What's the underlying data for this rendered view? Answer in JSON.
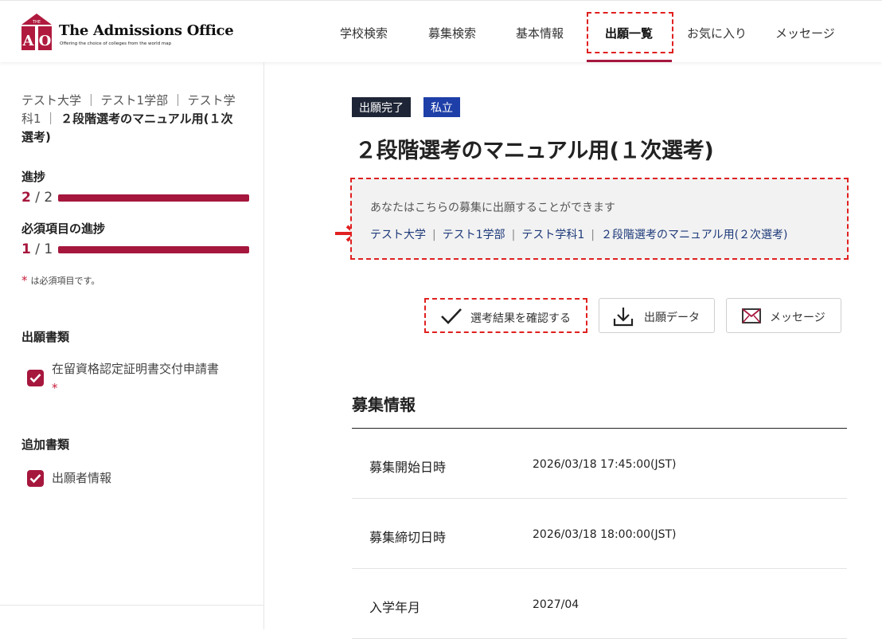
{
  "header": {
    "logo_title": "The Admissions Office",
    "logo_tagline": "Offering the choice of colleges from the world map",
    "logo_mark_text": "AO",
    "logo_mark_small": "THE",
    "nav": [
      "学校検索",
      "募集検索",
      "基本情報",
      "出願一覧",
      "お気に入り",
      "メッセージ"
    ],
    "active_nav": "出願一覧"
  },
  "sidebar": {
    "breadcrumb_line1": "テスト大学 ｜ テスト1学部 ｜ テスト学",
    "breadcrumb_line2": "科1 ｜",
    "breadcrumb_bold": "２段階選考のマニュアル用(１次選考)",
    "progress_label": "進捗",
    "progress_current": "2",
    "progress_total": "/ 2",
    "progress_fraction": 1.0,
    "required_label": "必須項目の進捗",
    "required_current": "1",
    "required_total": "/ 1",
    "required_fraction": 1.0,
    "required_star": "*",
    "required_note": "は必須項目です。",
    "documents_label": "出願書類",
    "documents": [
      {
        "label": "在留資格認定証明書交付申請書",
        "required": true,
        "checked": true
      }
    ],
    "additional_label": "追加書類",
    "additional": [
      {
        "label": "出願者情報",
        "checked": true
      }
    ]
  },
  "main": {
    "tags": [
      "出願完了",
      "私立"
    ],
    "title": "２段階選考のマニュアル用(１次選考)",
    "info_text": "あなたはこちらの募集に出願することができます",
    "info_link_parts": [
      "テスト大学",
      "テスト1学部",
      "テスト学科1",
      "２段階選考のマニュアル用(２次選考)"
    ],
    "buttons": {
      "check_results": "選考結果を確認する",
      "download": "出願データ",
      "message": "メッセージ"
    },
    "section_title": "募集情報",
    "rows": [
      {
        "label": "募集開始日時",
        "value": "2026/03/18 17:45:00(JST)"
      },
      {
        "label": "募集締切日時",
        "value": "2026/03/18 18:00:00(JST)"
      },
      {
        "label": "入学年月",
        "value": "2027/04"
      }
    ]
  },
  "colors": {
    "accent": "#a6173d",
    "tag_dark": "#1e2536",
    "tag_blue": "#1e3fa8",
    "link": "#1e3a7a",
    "highlight": "#e02020"
  }
}
